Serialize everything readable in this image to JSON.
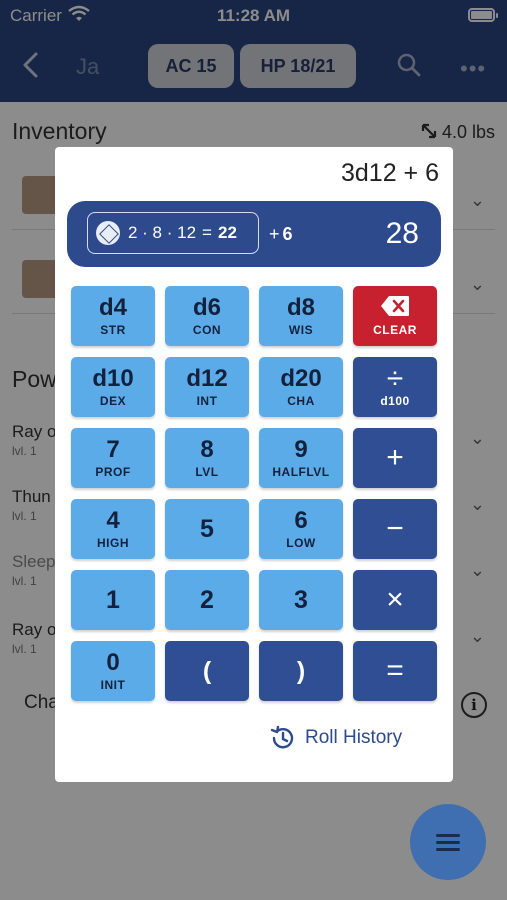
{
  "status": {
    "carrier": "Carrier",
    "time": "11:28 AM"
  },
  "nav": {
    "name": "Ja",
    "ac": "AC 15",
    "hp": "HP 18/21",
    "more": "•••"
  },
  "background": {
    "inventory_title": "Inventory",
    "inventory_weight": "4.0 lbs",
    "powers_title": "Pow",
    "powers": [
      {
        "name": "Ray o",
        "level": "lvl. 1"
      },
      {
        "name": "Thun",
        "level": "lvl. 1"
      },
      {
        "name": "Sleep",
        "level": "lvl. 1"
      },
      {
        "name": "Ray o",
        "level": "lvl. 1"
      }
    ],
    "cha_label": "Cha",
    "info_glyph": "i"
  },
  "calculator": {
    "expression": "3d12 + 6",
    "roll": {
      "dice": "2 · 8 · 12",
      "equals": "=",
      "sum": "22",
      "plus": "+",
      "modifier": "6"
    },
    "total": "28",
    "keys": [
      {
        "main": "d4",
        "sub": "STR"
      },
      {
        "main": "d6",
        "sub": "CON"
      },
      {
        "main": "d8",
        "sub": "WIS"
      },
      {
        "main": "",
        "sub": "CLEAR"
      },
      {
        "main": "d10",
        "sub": "DEX"
      },
      {
        "main": "d12",
        "sub": "INT"
      },
      {
        "main": "d20",
        "sub": "CHA"
      },
      {
        "main": "÷",
        "sub": "d100"
      },
      {
        "main": "7",
        "sub": "PROF"
      },
      {
        "main": "8",
        "sub": "LVL"
      },
      {
        "main": "9",
        "sub": "HALFLVL"
      },
      {
        "main": "+",
        "sub": ""
      },
      {
        "main": "4",
        "sub": "HIGH"
      },
      {
        "main": "5",
        "sub": ""
      },
      {
        "main": "6",
        "sub": "LOW"
      },
      {
        "main": "−",
        "sub": ""
      },
      {
        "main": "1",
        "sub": ""
      },
      {
        "main": "2",
        "sub": ""
      },
      {
        "main": "3",
        "sub": ""
      },
      {
        "main": "×",
        "sub": ""
      },
      {
        "main": "0",
        "sub": "INIT"
      },
      {
        "main": "(",
        "sub": ""
      },
      {
        "main": ")",
        "sub": ""
      },
      {
        "main": "=",
        "sub": ""
      }
    ],
    "history_label": "Roll History"
  },
  "colors": {
    "nav": "#2b4680",
    "light_key": "#5cabe9",
    "dark_key": "#2f4e93",
    "clear_key": "#c7212f"
  }
}
